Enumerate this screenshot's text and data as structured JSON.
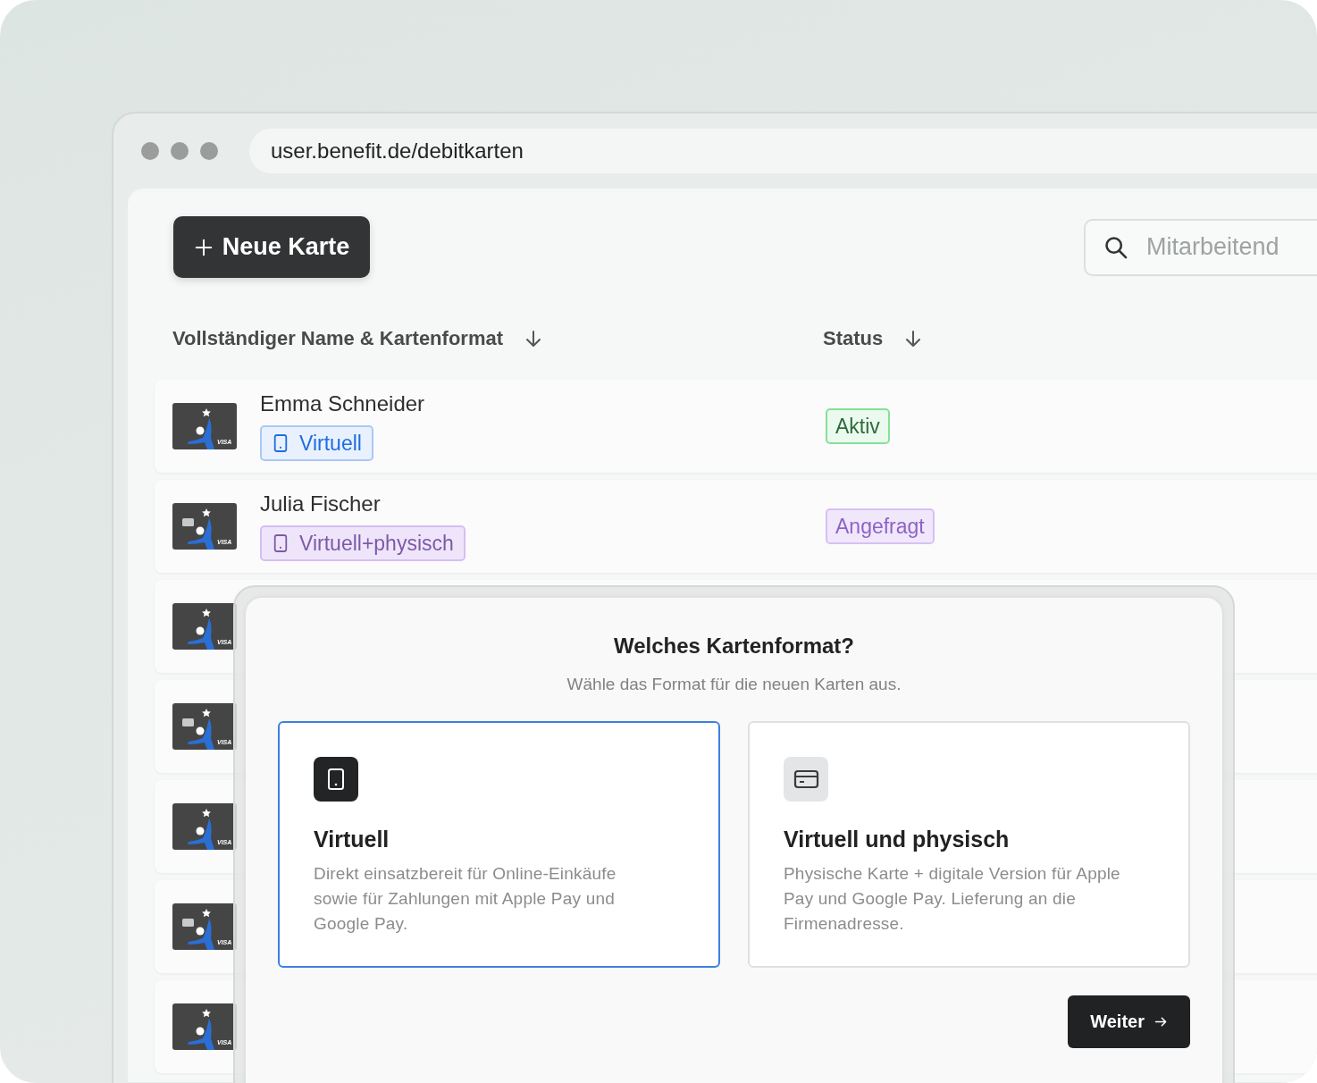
{
  "browser": {
    "url": "user.benefit.de/debitkarten"
  },
  "toolbar": {
    "new_button": "Neue Karte",
    "search": {
      "placeholder": "Mitarbeitend"
    }
  },
  "table": {
    "columns": [
      "Vollständiger Name & Kartenformat",
      "Status"
    ],
    "rows": [
      {
        "card": {
          "physical": false,
          "brand": "VISA"
        },
        "name": "Emma Schneider",
        "format": {
          "kind": "virtual",
          "label": "Virtuell"
        },
        "status": {
          "kind": "active",
          "label": "Aktiv"
        }
      },
      {
        "card": {
          "physical": true,
          "brand": "VISA"
        },
        "name": "Julia Fischer",
        "format": {
          "kind": "both",
          "label": "Virtuell+physisch"
        },
        "status": {
          "kind": "requested",
          "label": "Angefragt"
        }
      },
      {
        "card": {
          "physical": false,
          "brand": "VISA"
        }
      },
      {
        "card": {
          "physical": true,
          "brand": "VISA"
        }
      },
      {
        "card": {
          "physical": false,
          "brand": "VISA"
        }
      },
      {
        "card": {
          "physical": true,
          "brand": "VISA"
        }
      },
      {
        "card": {
          "physical": false,
          "brand": "VISA"
        }
      }
    ]
  },
  "modal": {
    "title": "Welches Kartenformat?",
    "subtitle": "Wähle das Format für die neuen Karten aus.",
    "options": [
      {
        "kind": "phone",
        "title": "Virtuell",
        "description": "Direkt einsatzbereit für Online-Einkäufe sowie für Zahlungen mit Apple Pay und Google Pay.",
        "selected": true
      },
      {
        "kind": "card",
        "title": "Virtuell und physisch",
        "description": "Physische Karte + digitale Version für Apple Pay und Google Pay. Lieferung an die Firmenadresse.",
        "selected": false
      }
    ],
    "button": "Weiter"
  }
}
